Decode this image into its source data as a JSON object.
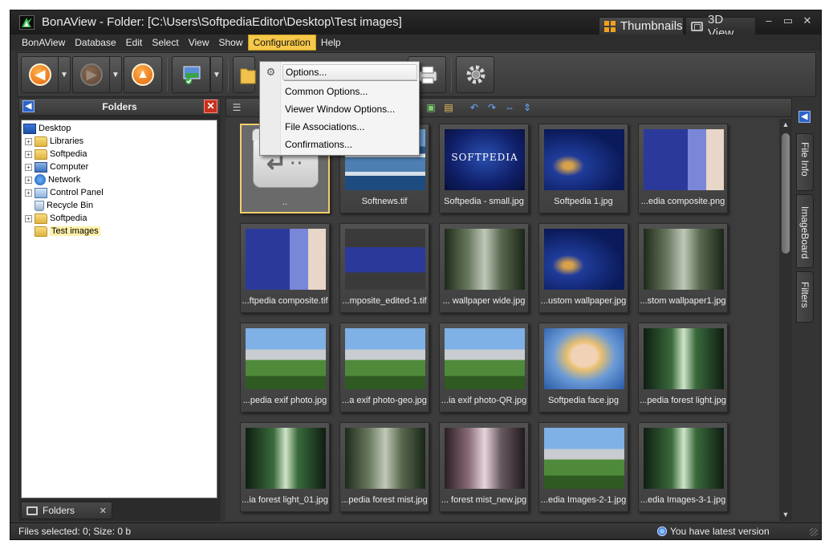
{
  "titlebar": {
    "title": "BonAView - Folder: [C:\\Users\\SoftpediaEditor\\Desktop\\Test images]",
    "thumbnails_label": "Thumbnails",
    "view3d_label": "3D View",
    "min": "–",
    "max": "▭",
    "close": "✕"
  },
  "menubar": {
    "items": [
      "BonAView",
      "Database",
      "Edit",
      "Select",
      "View",
      "Show",
      "Configuration",
      "Help"
    ],
    "active": "Configuration"
  },
  "toolbar": {
    "back_icon": "back-arrow-icon",
    "forward_icon": "forward-arrow-icon",
    "up_icon": "up-arrow-icon"
  },
  "configuration_menu": {
    "items": [
      "Options...",
      "Common Options...",
      "Viewer Window Options...",
      "File Associations...",
      "Confirmations..."
    ]
  },
  "folders_panel": {
    "title": "Folders",
    "tree": [
      {
        "label": "Desktop",
        "icon": "desktop-icon",
        "expander": ""
      },
      {
        "label": "Libraries",
        "icon": "folder-icon",
        "expander": "+"
      },
      {
        "label": "Softpedia",
        "icon": "folder-icon",
        "expander": "+"
      },
      {
        "label": "Computer",
        "icon": "computer-icon",
        "expander": "+"
      },
      {
        "label": "Network",
        "icon": "network-icon",
        "expander": "+"
      },
      {
        "label": "Control Panel",
        "icon": "control-panel-icon",
        "expander": "+"
      },
      {
        "label": "Recycle Bin",
        "icon": "recycle-bin-icon",
        "expander": ""
      },
      {
        "label": "Softpedia",
        "icon": "folder-icon",
        "expander": "+"
      },
      {
        "label": "Test images",
        "icon": "folder-icon",
        "expander": "",
        "selected": true
      }
    ],
    "bottom_tab_label": "Folders",
    "bottom_tab_close": "✕"
  },
  "thumbnails": [
    {
      "caption": "..",
      "kind": "up"
    },
    {
      "caption": "Softnews.tif",
      "kind": "city"
    },
    {
      "caption": "Softpedia  - small.jpg",
      "kind": "brand"
    },
    {
      "caption": "Softpedia 1.jpg",
      "kind": "swirl"
    },
    {
      "caption": "...edia composite.png",
      "kind": "composite"
    },
    {
      "caption": "...ftpedia composite.tif",
      "kind": "composite"
    },
    {
      "caption": "...mposite_edited-1.tif",
      "kind": "composite-wide"
    },
    {
      "caption": "... wallpaper wide.jpg",
      "kind": "forest"
    },
    {
      "caption": "...ustom wallpaper.jpg",
      "kind": "swirl"
    },
    {
      "caption": "...stom wallpaper1.jpg",
      "kind": "forest"
    },
    {
      "caption": "...pedia exif photo.jpg",
      "kind": "mountain"
    },
    {
      "caption": "...a exif photo-geo.jpg",
      "kind": "mountain"
    },
    {
      "caption": "...ia exif photo-QR.jpg",
      "kind": "mountain"
    },
    {
      "caption": "Softpedia face.jpg",
      "kind": "face"
    },
    {
      "caption": "...pedia forest light.jpg",
      "kind": "forest-light"
    },
    {
      "caption": "...ia forest light_01.jpg",
      "kind": "forest-light"
    },
    {
      "caption": "...pedia forest mist.jpg",
      "kind": "forest"
    },
    {
      "caption": "... forest mist_new.jpg",
      "kind": "forest-pink"
    },
    {
      "caption": "...edia Images-2-1.jpg",
      "kind": "mountain"
    },
    {
      "caption": "...edia Images-3-1.jpg",
      "kind": "forest-light"
    }
  ],
  "brand_text": "SOFTPEDIA",
  "right_tabs": [
    "File Info",
    "ImageBoard",
    "Filters"
  ],
  "statusbar": {
    "left": "Files selected: 0; Size: 0 b",
    "right": "You have latest version"
  }
}
